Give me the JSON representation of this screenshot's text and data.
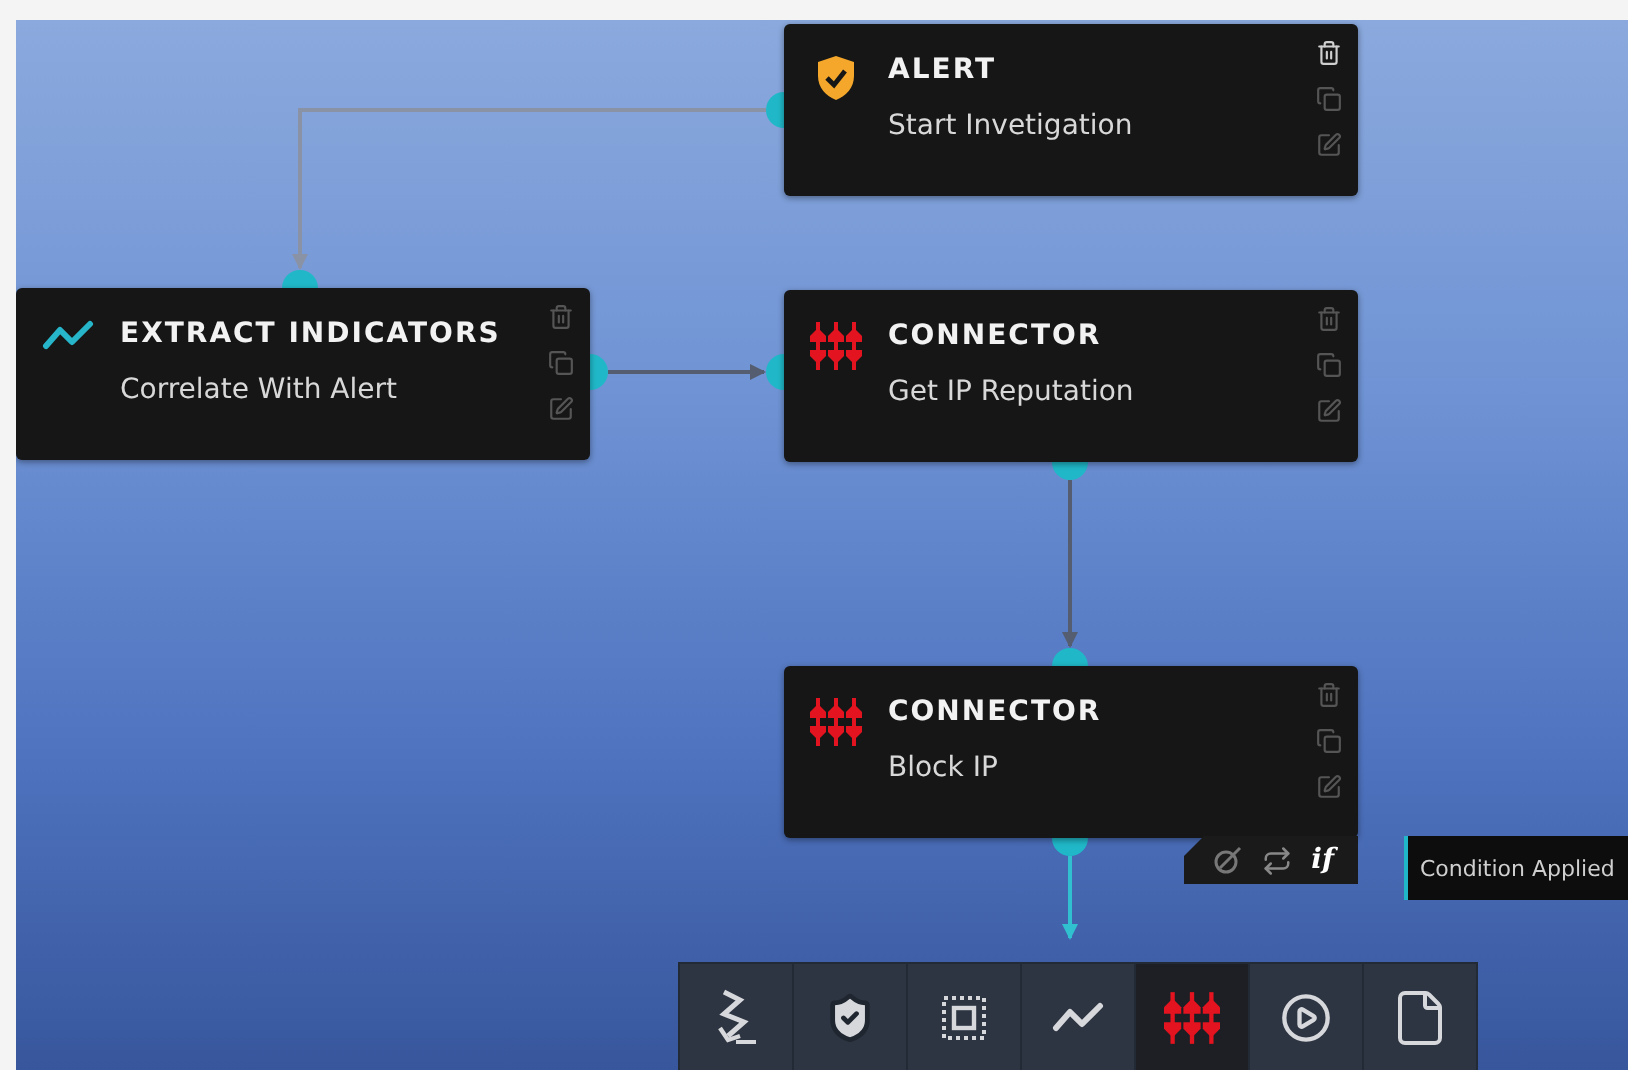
{
  "nodes": [
    {
      "kind": "alert",
      "title": "ALERT",
      "subtitle": "Start Invetigation"
    },
    {
      "kind": "extract",
      "title": "EXTRACT INDICATORS",
      "subtitle": "Correlate With Alert"
    },
    {
      "kind": "connector",
      "title": "CONNECTOR",
      "subtitle": "Get IP Reputation"
    },
    {
      "kind": "connector",
      "title": "CONNECTOR",
      "subtitle": "Block IP"
    }
  ],
  "condition_bar": {
    "label": "if"
  },
  "tooltip": {
    "text": "Condition Applied"
  },
  "toolbar": [
    {
      "kind": "trigger",
      "selected": false
    },
    {
      "kind": "alert",
      "selected": false
    },
    {
      "kind": "container",
      "selected": false
    },
    {
      "kind": "extract",
      "selected": false
    },
    {
      "kind": "connector",
      "selected": true
    },
    {
      "kind": "run",
      "selected": false
    },
    {
      "kind": "document",
      "selected": false
    }
  ]
}
